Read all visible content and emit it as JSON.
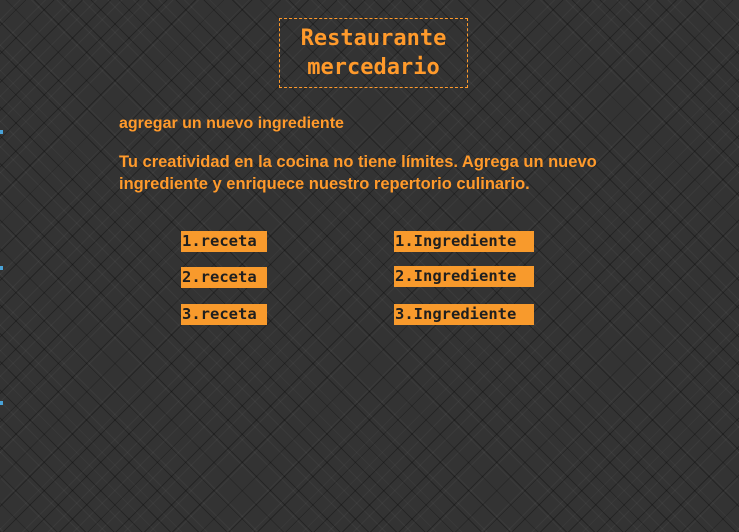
{
  "header": {
    "title_line1": "Restaurante",
    "title_line2": "mercedario"
  },
  "main": {
    "subtitle": "agregar un nuevo ingrediente",
    "description": "Tu creatividad en la cocina no tiene límites. Agrega un nuevo ingrediente y enriquece nuestro repertorio culinario."
  },
  "recipes": [
    {
      "label": "1.receta"
    },
    {
      "label": "2.receta"
    },
    {
      "label": "3.receta"
    }
  ],
  "ingredients": [
    {
      "label": "1.Ingrediente"
    },
    {
      "label": "2.Ingrediente"
    },
    {
      "label": "3.Ingrediente"
    }
  ],
  "colors": {
    "background": "#333333",
    "accent": "#ff9a2b",
    "pill_background": "#f89a2c",
    "pill_text": "#1f1f1f"
  }
}
